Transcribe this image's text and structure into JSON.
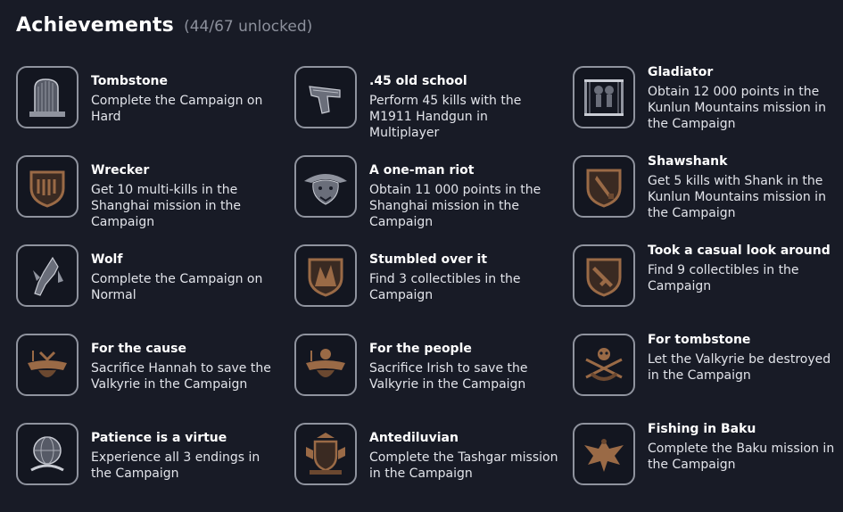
{
  "header": {
    "title": "Achievements",
    "count": "(44/67 unlocked)"
  },
  "colors": {
    "background": "#181b26",
    "icon_border": "#8f939e",
    "bronze": "#9a6a46",
    "silver": "#c9ccd4",
    "muted": "#8c909c"
  },
  "achievements": [
    {
      "name": "Tombstone",
      "desc": "Complete the Campaign on Hard",
      "icon": "tombstone-icon"
    },
    {
      "name": ".45 old school",
      "desc": "Perform 45 kills with the M1911 Handgun in Multiplayer",
      "icon": "handgun-icon"
    },
    {
      "name": "Gladiator",
      "desc": "Obtain 12 000 points in the Kunlun Mountains mission in the Campaign",
      "icon": "gladiator-icon"
    },
    {
      "name": "Wrecker",
      "desc": "Get 10 multi-kills in the Shanghai mission in the Campaign",
      "icon": "wrecker-shield-icon"
    },
    {
      "name": "A one-man riot",
      "desc": "Obtain 11 000 points in the Shanghai mission in the Campaign",
      "icon": "beast-icon"
    },
    {
      "name": "Shawshank",
      "desc": "Get 5 kills with Shank in the Kunlun Mountains mission in the Campaign",
      "icon": "shank-shield-icon"
    },
    {
      "name": "Wolf",
      "desc": "Complete the Campaign on Normal",
      "icon": "wolf-icon"
    },
    {
      "name": "Stumbled over it",
      "desc": "Find 3 collectibles in the Campaign",
      "icon": "collectible-shield-icon"
    },
    {
      "name": "Took a casual look around",
      "desc": "Find 9 collectibles in the Campaign",
      "icon": "rifle-shield-icon"
    },
    {
      "name": "For the cause",
      "desc": "Sacrifice Hannah to save the Valkyrie in the Campaign",
      "icon": "valkyrie-icon"
    },
    {
      "name": "For the people",
      "desc": "Sacrifice Irish to save the Valkyrie in the Campaign",
      "icon": "valkyrie-icon"
    },
    {
      "name": "For tombstone",
      "desc": "Let the Valkyrie be destroyed in the Campaign",
      "icon": "skull-valkyrie-icon"
    },
    {
      "name": "Patience is a virtue",
      "desc": "Experience all 3 endings in the Campaign",
      "icon": "globe-icon"
    },
    {
      "name": "Antediluvian",
      "desc": "Complete the Tashgar mission in the Campaign",
      "icon": "crest-icon"
    },
    {
      "name": "Fishing in Baku",
      "desc": "Complete the Baku mission in the Campaign",
      "icon": "eagle-icon"
    }
  ]
}
